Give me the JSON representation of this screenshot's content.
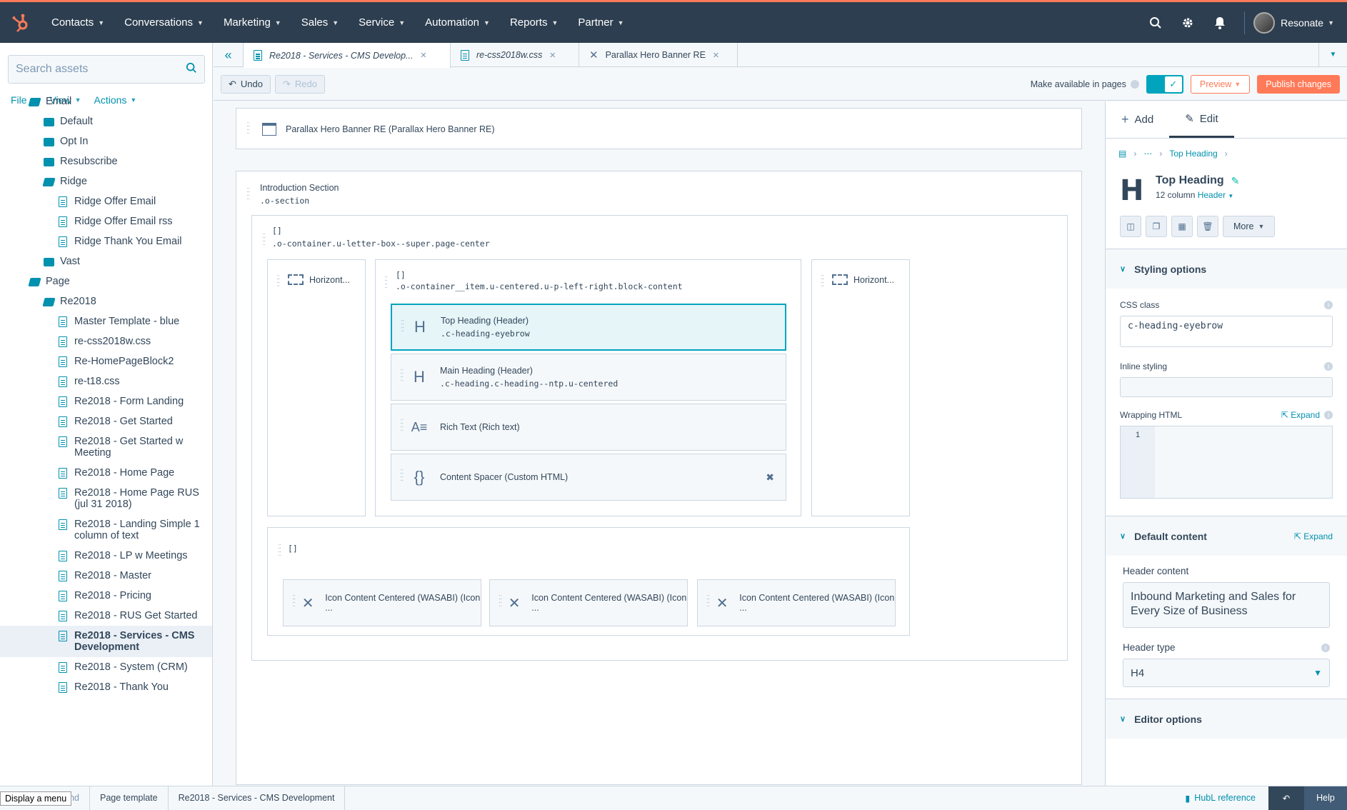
{
  "nav": {
    "items": [
      {
        "label": "Contacts"
      },
      {
        "label": "Conversations"
      },
      {
        "label": "Marketing"
      },
      {
        "label": "Sales"
      },
      {
        "label": "Service"
      },
      {
        "label": "Automation"
      },
      {
        "label": "Reports"
      },
      {
        "label": "Partner"
      }
    ],
    "account": "Resonate"
  },
  "sidebar": {
    "search_placeholder": "Search assets",
    "menus": [
      "File",
      "View",
      "Actions"
    ],
    "items": [
      {
        "label": "Email",
        "type": "folder-open",
        "indent": 1
      },
      {
        "label": "Default",
        "type": "folder",
        "indent": 2
      },
      {
        "label": "Opt In",
        "type": "folder",
        "indent": 2
      },
      {
        "label": "Resubscribe",
        "type": "folder",
        "indent": 2
      },
      {
        "label": "Ridge",
        "type": "folder-open",
        "indent": 2
      },
      {
        "label": "Ridge Offer Email",
        "type": "file",
        "indent": 3
      },
      {
        "label": "Ridge Offer Email rss",
        "type": "file",
        "indent": 3
      },
      {
        "label": "Ridge Thank You Email",
        "type": "file",
        "indent": 3
      },
      {
        "label": "Vast",
        "type": "folder",
        "indent": 2
      },
      {
        "label": "Page",
        "type": "folder-open",
        "indent": 1
      },
      {
        "label": "Re2018",
        "type": "folder-open",
        "indent": 2
      },
      {
        "label": "Master Template - blue",
        "type": "file",
        "indent": 3
      },
      {
        "label": "re-css2018w.css",
        "type": "file",
        "indent": 3
      },
      {
        "label": "Re-HomePageBlock2",
        "type": "file",
        "indent": 3
      },
      {
        "label": "re-t18.css",
        "type": "file",
        "indent": 3
      },
      {
        "label": "Re2018 - Form Landing",
        "type": "file",
        "indent": 3
      },
      {
        "label": "Re2018 - Get Started",
        "type": "file",
        "indent": 3
      },
      {
        "label": "Re2018 - Get Started w Meeting",
        "type": "file",
        "indent": 3
      },
      {
        "label": "Re2018 - Home Page",
        "type": "file",
        "indent": 3
      },
      {
        "label": "Re2018 - Home Page RUS (jul 31 2018)",
        "type": "file",
        "indent": 3
      },
      {
        "label": "Re2018 - Landing Simple 1 column of text",
        "type": "file",
        "indent": 3
      },
      {
        "label": "Re2018 - LP w Meetings",
        "type": "file",
        "indent": 3
      },
      {
        "label": "Re2018 - Master",
        "type": "file",
        "indent": 3
      },
      {
        "label": "Re2018 - Pricing",
        "type": "file",
        "indent": 3
      },
      {
        "label": "Re2018 - RUS Get Started",
        "type": "file",
        "indent": 3
      },
      {
        "label": "Re2018 - Services - CMS Development",
        "type": "file",
        "indent": 3,
        "selected": true
      },
      {
        "label": "Re2018 - System (CRM)",
        "type": "file",
        "indent": 3
      },
      {
        "label": "Re2018 - Thank You",
        "type": "file",
        "indent": 3
      }
    ]
  },
  "tabs": [
    {
      "label": "Re2018 - Services - CMS Develop...",
      "active": true
    },
    {
      "label": "re-css2018w.css",
      "active": false
    },
    {
      "label": "Parallax Hero Banner RE",
      "active": false
    }
  ],
  "toolbar": {
    "undo": "Undo",
    "redo": "Redo",
    "available": "Make available in pages",
    "preview": "Preview",
    "publish": "Publish changes"
  },
  "canvas": {
    "banner": "Parallax Hero Banner RE (Parallax Hero Banner RE)",
    "intro_title": "Introduction Section",
    "intro_class": ".o-section",
    "bracket": "[]",
    "container_class": ".o-container.u-letter-box--super.page-center",
    "horiz_left": "Horizont...",
    "horiz_right": "Horizont...",
    "item_class": ".o-container__item.u-centered.u-p-left-right.block-content",
    "modules": [
      {
        "title": "Top Heading (Header)",
        "cls": ".c-heading-eyebrow",
        "icon": "H"
      },
      {
        "title": "Main Heading (Header)",
        "cls": ".c-heading.c-heading--ntp.u-centered",
        "icon": "H"
      },
      {
        "title": "Rich Text (Rich text)",
        "cls": "",
        "icon": "A"
      },
      {
        "title": "Content Spacer (Custom HTML)",
        "cls": "",
        "icon": "{}"
      }
    ],
    "icon_modules": [
      "Icon Content Centered (WASABI) (Icon ...",
      "Icon Content Centered (WASABI) (Icon ...",
      "Icon Content Centered (WASABI) (Icon ..."
    ]
  },
  "right": {
    "add": "Add",
    "edit": "Edit",
    "crumb": "Top Heading",
    "title": "Top Heading",
    "sub_prefix": "12 column",
    "sub_link": "Header",
    "more": "More",
    "styling": "Styling options",
    "css_label": "CSS class",
    "css_value": "c-heading-eyebrow",
    "inline_label": "Inline styling",
    "wrap_label": "Wrapping HTML",
    "expand": "Expand",
    "line_no": "1",
    "default_content": "Default content",
    "header_content_label": "Header content",
    "header_content": "Inbound Marketing and Sales for Every Size of Business",
    "header_type_label": "Header type",
    "header_type": "H4",
    "editor_options": "Editor options"
  },
  "status": {
    "menu": "Display a menu",
    "trail_1": "und",
    "trail_2": "Page template",
    "trail_3": "Re2018 - Services - CMS Development",
    "hubl": "HubL reference",
    "help": "Help"
  },
  "colors": {
    "accent": "#ff7a59",
    "teal": "#00a4bd",
    "navy": "#2d3e50"
  }
}
